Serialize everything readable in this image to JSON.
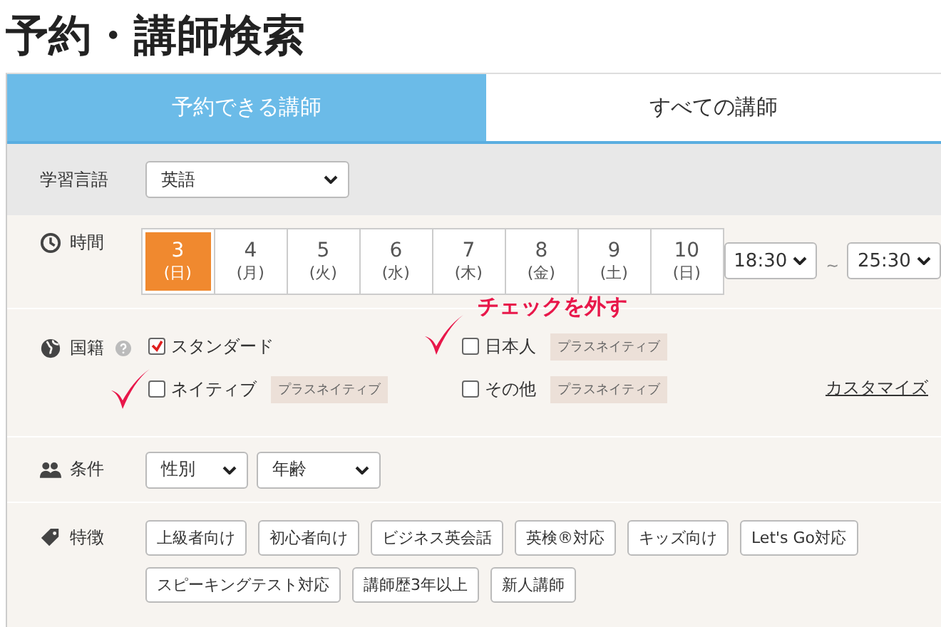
{
  "title": "予約・講師検索",
  "tabs": [
    {
      "label": "予約できる講師",
      "selected": true
    },
    {
      "label": "すべての講師",
      "selected": false
    }
  ],
  "language": {
    "label": "学習言語",
    "value": "英語"
  },
  "time": {
    "label": "時間",
    "dates": [
      {
        "day": "3",
        "weekday": "(日)",
        "selected": true
      },
      {
        "day": "4",
        "weekday": "(月)",
        "selected": false
      },
      {
        "day": "5",
        "weekday": "(火)",
        "selected": false
      },
      {
        "day": "6",
        "weekday": "(水)",
        "selected": false
      },
      {
        "day": "7",
        "weekday": "(木)",
        "selected": false
      },
      {
        "day": "8",
        "weekday": "(金)",
        "selected": false
      },
      {
        "day": "9",
        "weekday": "(土)",
        "selected": false
      },
      {
        "day": "10",
        "weekday": "(日)",
        "selected": false
      }
    ],
    "from": "18:30",
    "separator": "~",
    "to": "25:30"
  },
  "nationality": {
    "label": "国籍",
    "options": [
      {
        "label": "スタンダード",
        "checked": true
      },
      {
        "label": "日本人",
        "checked": false,
        "badge": "プラスネイティブ"
      },
      {
        "label": "ネイティブ",
        "checked": false,
        "badge": "プラスネイティブ"
      },
      {
        "label": "その他",
        "checked": false,
        "badge": "プラスネイティブ"
      }
    ],
    "customize_link": "カスタマイズ"
  },
  "annotation": {
    "text": "チェックを外す"
  },
  "conditions": {
    "label": "条件",
    "selects": [
      "性別",
      "年齢"
    ]
  },
  "features": {
    "label": "特徴",
    "tags": [
      "上級者向け",
      "初心者向け",
      "ビジネス英会話",
      "英検®対応",
      "キッズ向け",
      "Let's Go対応",
      "スピーキングテスト対応",
      "講師歴3年以上",
      "新人講師"
    ]
  }
}
